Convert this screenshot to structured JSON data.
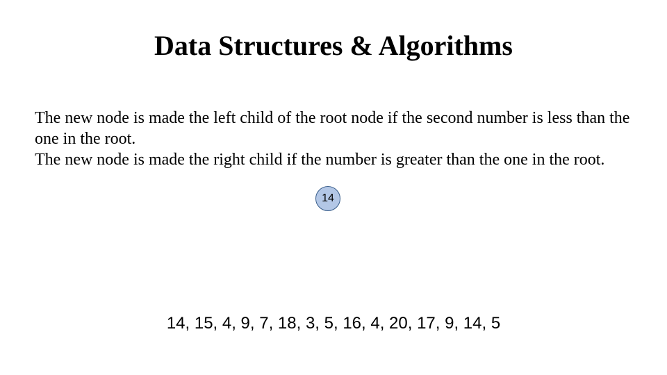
{
  "title": "Data Structures & Algorithms",
  "body": {
    "line1": "The new node is made the left child of the root node if the second number is less than the one in the root.",
    "line2": "The new node is made the right child if the number is greater than the one in the root."
  },
  "tree": {
    "root_value": "14"
  },
  "sequence": "14, 15, 4, 9, 7, 18, 3, 5, 16, 4, 20, 17, 9, 14, 5"
}
